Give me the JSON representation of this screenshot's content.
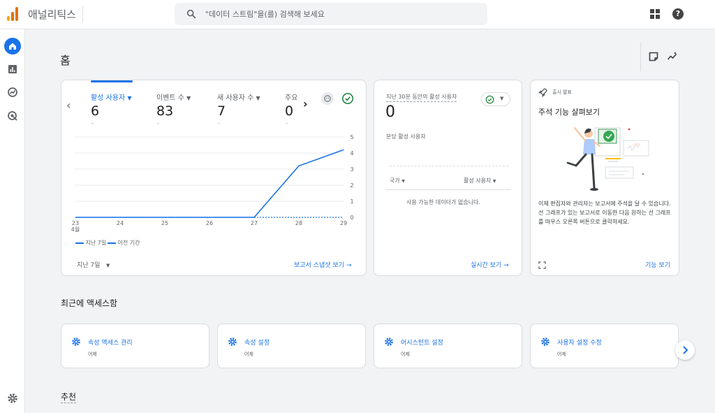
{
  "app": {
    "title": "애널리틱스",
    "search_placeholder": "\"데이터 스트림\"을(를) 검색해 보세요",
    "help_glyph": "?"
  },
  "colors": {
    "accent": "#1a73e8",
    "logo": [
      "#f9ab00",
      "#e37400",
      "#e37400"
    ],
    "check_green": "#188038"
  },
  "icons": {
    "rail": [
      "home-icon",
      "reports-icon",
      "explore-icon",
      "advertising-icon"
    ],
    "settings": "gear-icon",
    "header": [
      "notes-icon",
      "insights-icon"
    ]
  },
  "home": {
    "title": "홈"
  },
  "metrics_card": {
    "tabs": [
      {
        "label": "활성 사용자",
        "value": "6",
        "sub": "-"
      },
      {
        "label": "이벤트 수",
        "value": "83",
        "sub": "-"
      },
      {
        "label": "새 사용자 수",
        "value": "7",
        "sub": "-"
      },
      {
        "label": "주요",
        "value": "0",
        "sub": "-"
      }
    ],
    "date_range": "지난 7일",
    "snapshot_link": "보고서 스냅샷 보기"
  },
  "chart_data": {
    "type": "line",
    "x": [
      "23",
      "24",
      "25",
      "26",
      "27",
      "28",
      "29"
    ],
    "x_month_label": "4월",
    "series": [
      {
        "name": "지난 7일",
        "values": [
          0,
          0,
          0,
          0,
          0,
          3.2,
          4.2
        ],
        "style": "solid",
        "color": "#1a73e8"
      },
      {
        "name": "이전 기간",
        "values": [
          0,
          0,
          0,
          0,
          0,
          0,
          0
        ],
        "style": "dashed",
        "color": "#1a73e8"
      }
    ],
    "yticks": [
      0,
      1,
      2,
      3,
      4,
      5
    ],
    "ylim": [
      0,
      5
    ],
    "grid": true,
    "y_axis_side": "right",
    "legend_position": "bottom-left"
  },
  "realtime_card": {
    "label": "지난 30분 동안의 활성 사용자",
    "value": "0",
    "sub_label": "분당 활성 사용자",
    "col_country": "국가",
    "col_users": "활성 사용자",
    "empty": "사용 가능한 데이터가 없습니다.",
    "link": "실시간 보기"
  },
  "whats_new_card": {
    "tag": "출시 발표",
    "title": "주석 기능 살펴보기",
    "description": "이제 편집자와 관리자는 보고서에 주석을 달 수 있습니다. 선 그래프가 있는 보고서로 이동한 다음 원하는 선 그래프를 마우스 오른쪽 버튼으로 클릭하세요.",
    "link": "기능 보기"
  },
  "recent": {
    "title": "최근에 액세스함",
    "items": [
      {
        "label": "속성 액세스 관리",
        "time": "어제"
      },
      {
        "label": "속성 설정",
        "time": "어제"
      },
      {
        "label": "어시스턴트 설정",
        "time": "어제"
      },
      {
        "label": "사용자 설정 수정",
        "time": "어제"
      }
    ]
  },
  "recommended": {
    "title": "추천"
  }
}
